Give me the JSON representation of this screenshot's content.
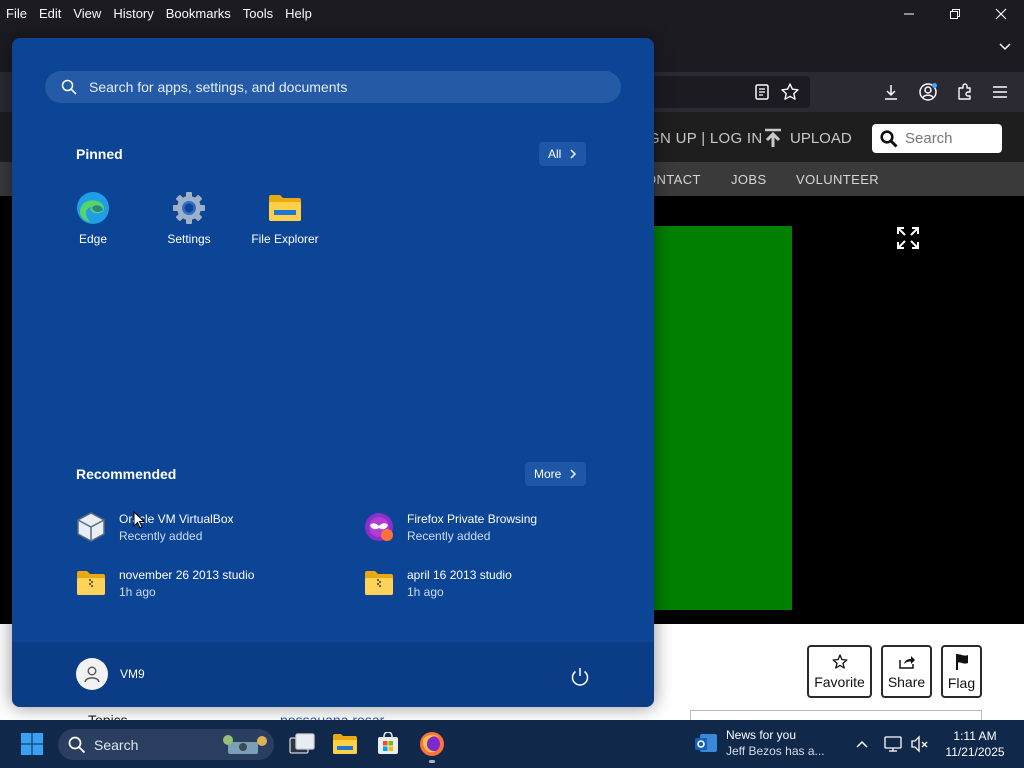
{
  "browser": {
    "menu": [
      "File",
      "Edit",
      "View",
      "History",
      "Bookmarks",
      "Tools",
      "Help"
    ]
  },
  "website": {
    "auth_links": "GN UP | LOG IN",
    "upload_label": "UPLOAD",
    "search_placeholder": "Search",
    "nav": [
      "ONTACT",
      "JOBS",
      "VOLUNTEER"
    ],
    "player_color": "#008000",
    "actions": {
      "favorite": "Favorite",
      "share": "Share",
      "flag": "Flag"
    },
    "topics_label": "Topics",
    "topic_link": "possauana rosar"
  },
  "start_menu": {
    "search_placeholder": "Search for apps, settings, and documents",
    "pinned_title": "Pinned",
    "all_label": "All",
    "pinned": [
      {
        "label": "Edge",
        "icon": "edge-icon"
      },
      {
        "label": "Settings",
        "icon": "settings-gear-icon"
      },
      {
        "label": "File Explorer",
        "icon": "folder-icon"
      }
    ],
    "recommended_title": "Recommended",
    "more_label": "More",
    "recommended": [
      {
        "name": "Oracle VM VirtualBox",
        "sub": "Recently added",
        "icon": "virtualbox-icon"
      },
      {
        "name": "Firefox Private Browsing",
        "sub": "Recently added",
        "icon": "firefox-private-icon"
      },
      {
        "name": "november 26 2013 studio",
        "sub": "1h ago",
        "icon": "zip-folder-icon"
      },
      {
        "name": "april 16 2013 studio",
        "sub": "1h ago",
        "icon": "zip-folder-icon"
      }
    ],
    "user_name": "VM9",
    "accent": "#0c4596"
  },
  "taskbar": {
    "search_label": "Search",
    "news_title": "News for you",
    "news_sub": "Jeff Bezos has a...",
    "time": "1:11 AM",
    "date": "11/21/2025"
  }
}
